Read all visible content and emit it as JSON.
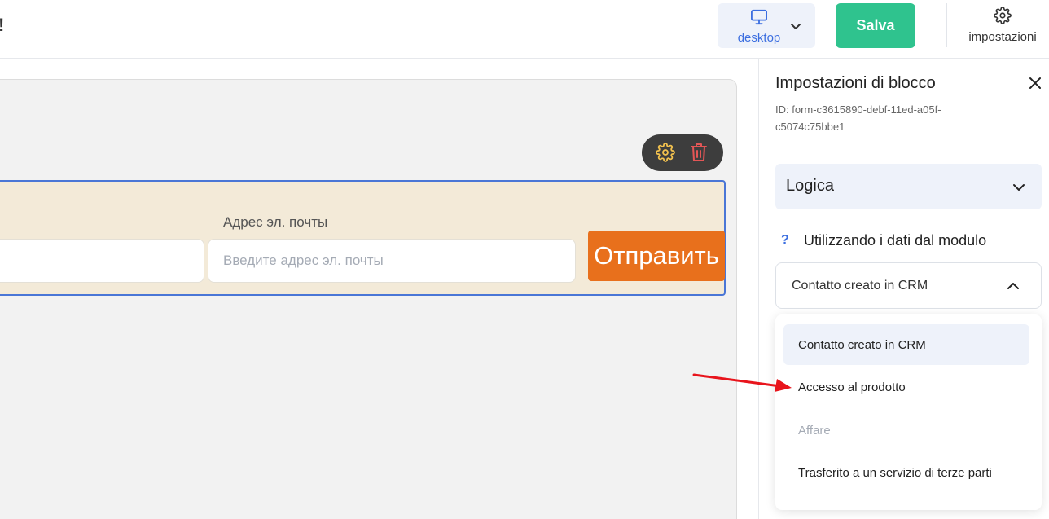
{
  "header": {
    "title_fragment": "!",
    "device": {
      "label": "desktop",
      "icon": "monitor-icon"
    },
    "save_label": "Salva",
    "settings": {
      "label": "impostazioni",
      "icon": "gear-icon"
    }
  },
  "canvas": {
    "form": {
      "email_label": "Адрес эл. почты",
      "email_placeholder": "Введите адрес эл. почты",
      "submit_label": "Отправить"
    },
    "block_toolbar": {
      "icons": [
        "gear-icon",
        "trash-icon"
      ]
    }
  },
  "panel": {
    "title": "Impostazioni di blocco",
    "block_id": "ID: form-c3615890-debf-11ed-a05f-c5074c75bbe1",
    "logic_section": "Logica",
    "help_mark": "?",
    "data_label": "Utilizzando i dati dal modulo",
    "select": {
      "value": "Contatto creato in CRM",
      "options": [
        {
          "label": "Contatto creato in CRM",
          "state": "selected"
        },
        {
          "label": "Accesso al prodotto",
          "state": "normal"
        },
        {
          "label": "Affare",
          "state": "disabled"
        },
        {
          "label": "Trasferito a un servizio di terze parti",
          "state": "normal"
        }
      ]
    }
  },
  "colors": {
    "accent_blue": "#3b6ee0",
    "save_green": "#2fc38e",
    "submit_orange": "#e8701c",
    "form_background": "#f3ead8",
    "annotation_red": "#e8141c"
  }
}
